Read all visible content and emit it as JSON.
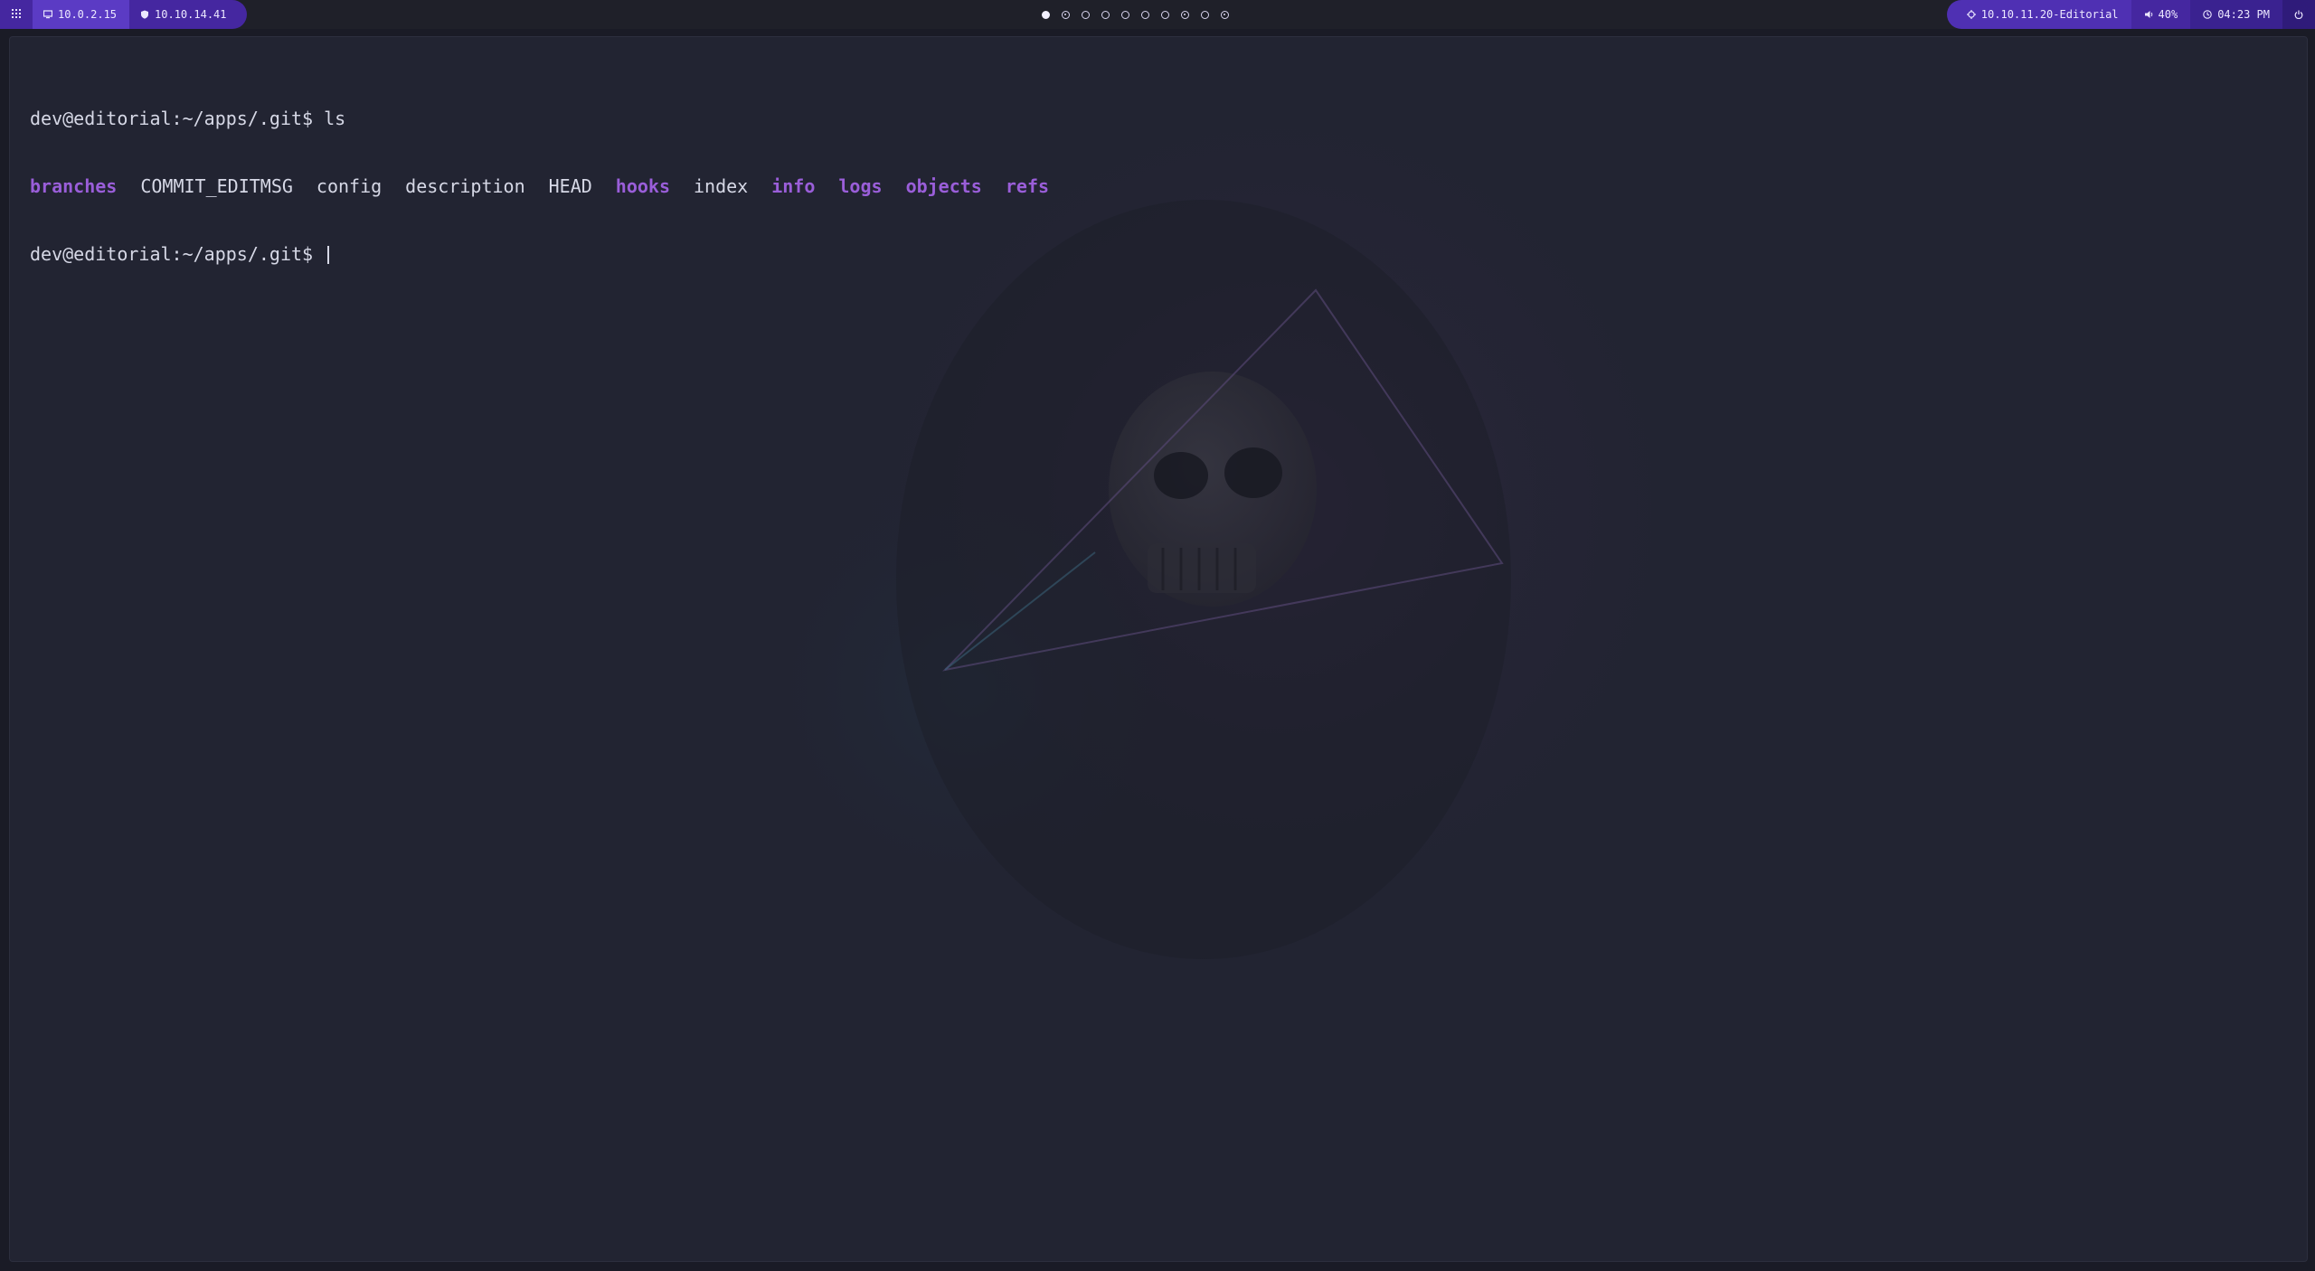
{
  "topbar": {
    "menu_icon": "grid-icon",
    "host_ip": "10.0.2.15",
    "host_icon": "monitor-icon",
    "vpn_ip": "10.10.14.41",
    "vpn_icon": "shield-icon",
    "workspaces": [
      {
        "state": "active"
      },
      {
        "state": "occupied"
      },
      {
        "state": "empty"
      },
      {
        "state": "empty"
      },
      {
        "state": "empty"
      },
      {
        "state": "empty"
      },
      {
        "state": "empty"
      },
      {
        "state": "occupied"
      },
      {
        "state": "empty"
      },
      {
        "state": "occupied"
      }
    ],
    "target": "10.10.11.20-Editorial",
    "target_icon": "crosshair-icon",
    "volume": "40%",
    "volume_icon": "speaker-icon",
    "time": "04:23 PM",
    "clock_icon": "clock-icon",
    "power_icon": "power-icon"
  },
  "terminal": {
    "prompt1": "dev@editorial:~/apps/.git$ ls",
    "ls_output": [
      {
        "name": "branches",
        "type": "dir"
      },
      {
        "name": "COMMIT_EDITMSG",
        "type": "file"
      },
      {
        "name": "config",
        "type": "file"
      },
      {
        "name": "description",
        "type": "file"
      },
      {
        "name": "HEAD",
        "type": "file"
      },
      {
        "name": "hooks",
        "type": "dir"
      },
      {
        "name": "index",
        "type": "file"
      },
      {
        "name": "info",
        "type": "dir"
      },
      {
        "name": "logs",
        "type": "dir"
      },
      {
        "name": "objects",
        "type": "dir"
      },
      {
        "name": "refs",
        "type": "dir"
      }
    ],
    "prompt2": "dev@editorial:~/apps/.git$ "
  },
  "colors": {
    "accent": "#5b3bc4",
    "directory": "#9a5ed9",
    "terminal_bg": "#222432",
    "text": "#d6d8e6"
  }
}
